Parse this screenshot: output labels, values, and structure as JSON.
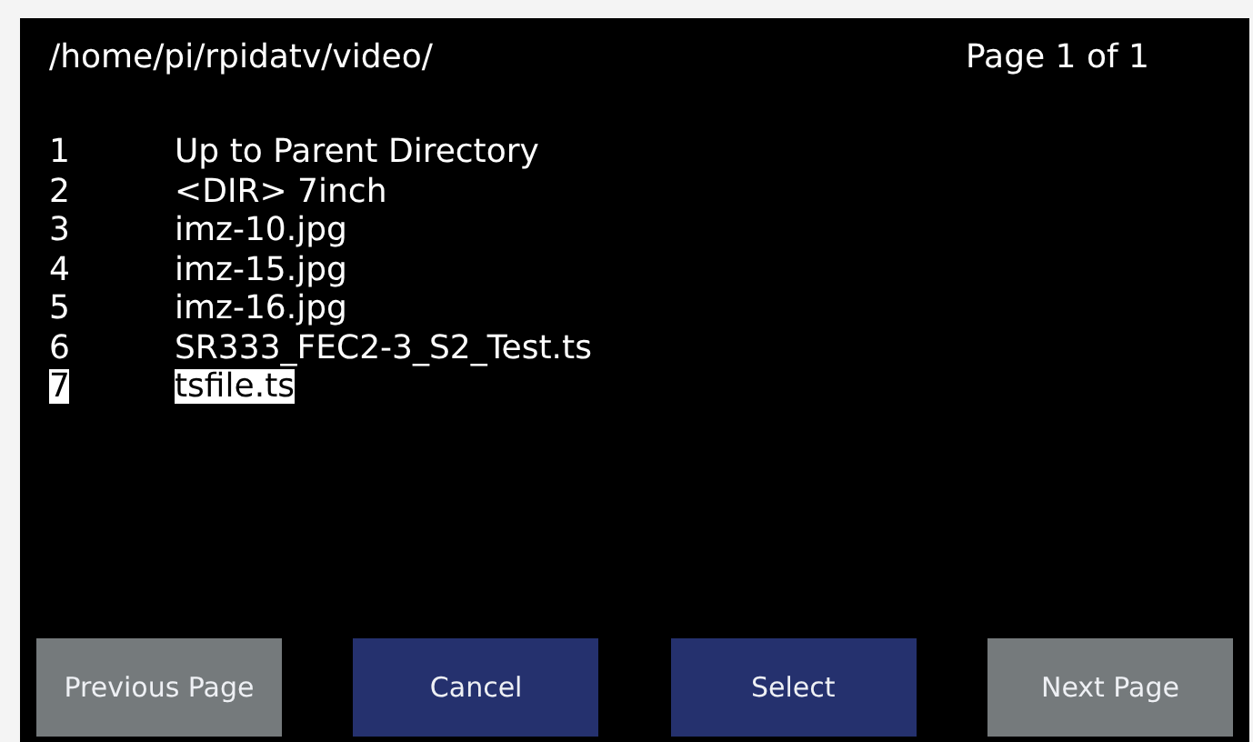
{
  "header": {
    "path": "/home/pi/rpidatv/video/",
    "page": "Page 1 of 1"
  },
  "files": [
    {
      "number": "1",
      "name": "Up to Parent Directory",
      "selected": false
    },
    {
      "number": "2",
      "name": "<DIR> 7inch",
      "selected": false
    },
    {
      "number": "3",
      "name": "imz-10.jpg",
      "selected": false
    },
    {
      "number": "4",
      "name": "imz-15.jpg",
      "selected": false
    },
    {
      "number": "5",
      "name": "imz-16.jpg",
      "selected": false
    },
    {
      "number": "6",
      "name": "SR333_FEC2-3_S2_Test.ts",
      "selected": false
    },
    {
      "number": "7",
      "name": "tsfile.ts",
      "selected": true
    }
  ],
  "buttons": [
    {
      "label": "Previous Page",
      "disabled": true
    },
    {
      "label": "Cancel",
      "disabled": false
    },
    {
      "label": "Select",
      "disabled": false
    },
    {
      "label": "Next Page",
      "disabled": true
    }
  ]
}
